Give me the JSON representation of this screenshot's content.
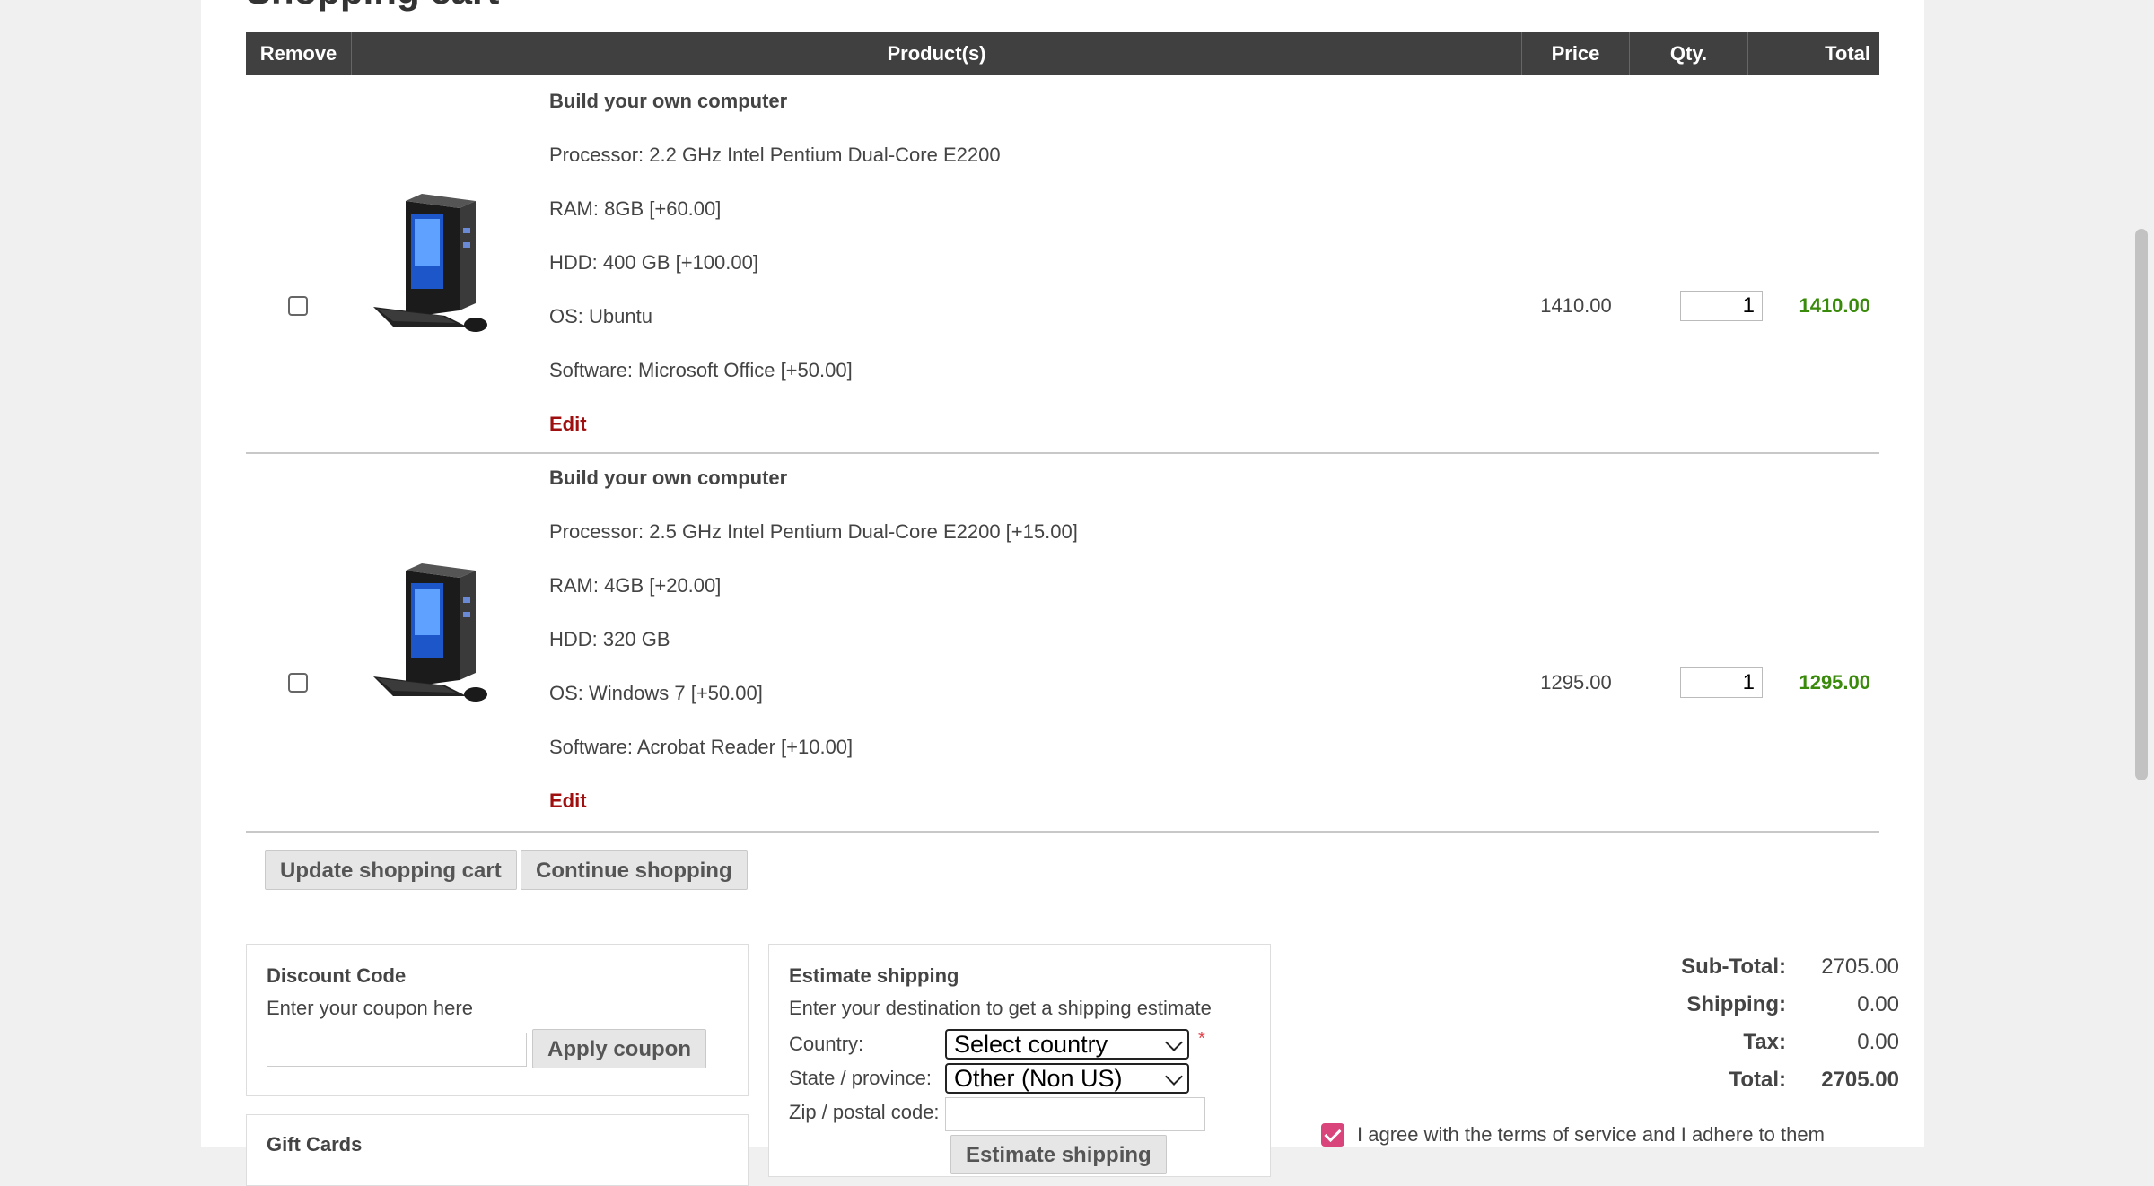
{
  "page": {
    "title_fragment": "Shopping cart"
  },
  "cart": {
    "headers": {
      "remove": "Remove",
      "products": "Product(s)",
      "price": "Price",
      "qty": "Qty.",
      "total": "Total"
    },
    "items": [
      {
        "name": "Build your own computer",
        "attributes": [
          "Processor: 2.2 GHz Intel Pentium Dual-Core E2200",
          "RAM: 8GB [+60.00]",
          "HDD: 400 GB [+100.00]",
          "OS: Ubuntu",
          "Software: Microsoft Office [+50.00]"
        ],
        "edit_label": "Edit",
        "unit_price": "1410.00",
        "quantity": "1",
        "total": "1410.00"
      },
      {
        "name": "Build your own computer",
        "attributes": [
          "Processor: 2.5 GHz Intel Pentium Dual-Core E2200 [+15.00]",
          "RAM: 4GB [+20.00]",
          "HDD: 320 GB",
          "OS: Windows 7 [+50.00]",
          "Software: Acrobat Reader [+10.00]"
        ],
        "edit_label": "Edit",
        "unit_price": "1295.00",
        "quantity": "1",
        "total": "1295.00"
      }
    ],
    "update_label": "Update shopping cart",
    "continue_label": "Continue shopping"
  },
  "discount": {
    "title": "Discount Code",
    "hint": "Enter your coupon here",
    "apply_label": "Apply coupon"
  },
  "gift_cards": {
    "title": "Gift Cards"
  },
  "shipping": {
    "title": "Estimate shipping",
    "hint": "Enter your destination to get a shipping estimate",
    "country_label": "Country:",
    "country_value": "Select country",
    "required_mark": "*",
    "state_label": "State / province:",
    "state_value": "Other (Non US)",
    "zip_label": "Zip / postal code:",
    "estimate_label": "Estimate shipping"
  },
  "totals": {
    "subtotal_label": "Sub-Total:",
    "subtotal_value": "2705.00",
    "shipping_label": "Shipping:",
    "shipping_value": "0.00",
    "tax_label": "Tax:",
    "tax_value": "0.00",
    "total_label": "Total:",
    "total_value": "2705.00"
  },
  "terms": {
    "text": "I agree with the terms of service and I adhere to them",
    "checked": true
  },
  "colors": {
    "header_bg": "#404040",
    "edit_link": "#a00f0f",
    "line_total": "#3a8a0c",
    "terms_checkbox": "#d9447a"
  }
}
